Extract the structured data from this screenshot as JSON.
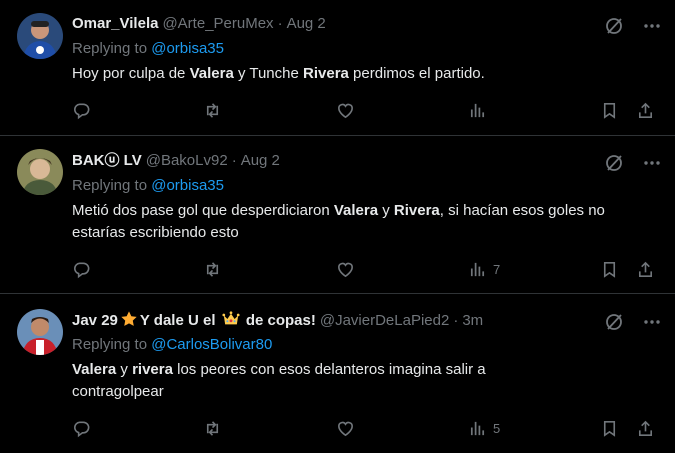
{
  "colors": {
    "background": "#000000",
    "text": "#e7e9ea",
    "muted": "#71767b",
    "link": "#1d9bf0",
    "divider": "#2f3336"
  },
  "tweets": [
    {
      "display_name": "Omar_Vilela",
      "handle": "@Arte_PeruMex",
      "dot": "·",
      "time": "Aug 2",
      "replying_prefix": "Replying to",
      "replying_to": "@orbisa35",
      "body": [
        {
          "t": "Hoy por culpa de ",
          "b": false
        },
        {
          "t": "Valera",
          "b": true
        },
        {
          "t": " y Tunche ",
          "b": false
        },
        {
          "t": "Rivera",
          "b": true
        },
        {
          "t": " perdimos el partido.",
          "b": false
        }
      ],
      "views": ""
    },
    {
      "display_name": "BAKⓤ LV",
      "handle": "@BakoLv92",
      "dot": "·",
      "time": "Aug 2",
      "replying_prefix": "Replying to",
      "replying_to": "@orbisa35",
      "body": [
        {
          "t": "Metió dos pase gol que desperdiciaron ",
          "b": false
        },
        {
          "t": "Valera",
          "b": true
        },
        {
          "t": " y ",
          "b": false
        },
        {
          "t": "Rivera",
          "b": true
        },
        {
          "t": ", si hacían esos goles no estarías escribiendo esto",
          "b": false
        }
      ],
      "views": "7"
    },
    {
      "display_name_parts": [
        "Jav 29",
        "Y dale U el",
        "de copas!"
      ],
      "display_name_icons": [
        "star-emoji-icon",
        "crown-emoji-icon"
      ],
      "handle": "@JavierDeLaPied2",
      "dot": "·",
      "time": "3m",
      "replying_prefix": "Replying to",
      "replying_to": "@CarlosBolivar80",
      "body": [
        {
          "t": "Valera",
          "b": true
        },
        {
          "t": " y ",
          "b": false
        },
        {
          "t": "rivera",
          "b": true
        },
        {
          "t": " los peores con esos delanteros imagina salir a contragolpear",
          "b": false
        }
      ],
      "views": "5"
    }
  ],
  "icons": {
    "reply": "reply-icon",
    "retweet": "retweet-icon",
    "like": "heart-icon",
    "views": "views-icon",
    "bookmark": "bookmark-icon",
    "share": "share-icon",
    "grok": "slashed-circle-icon",
    "more": "more-icon"
  }
}
